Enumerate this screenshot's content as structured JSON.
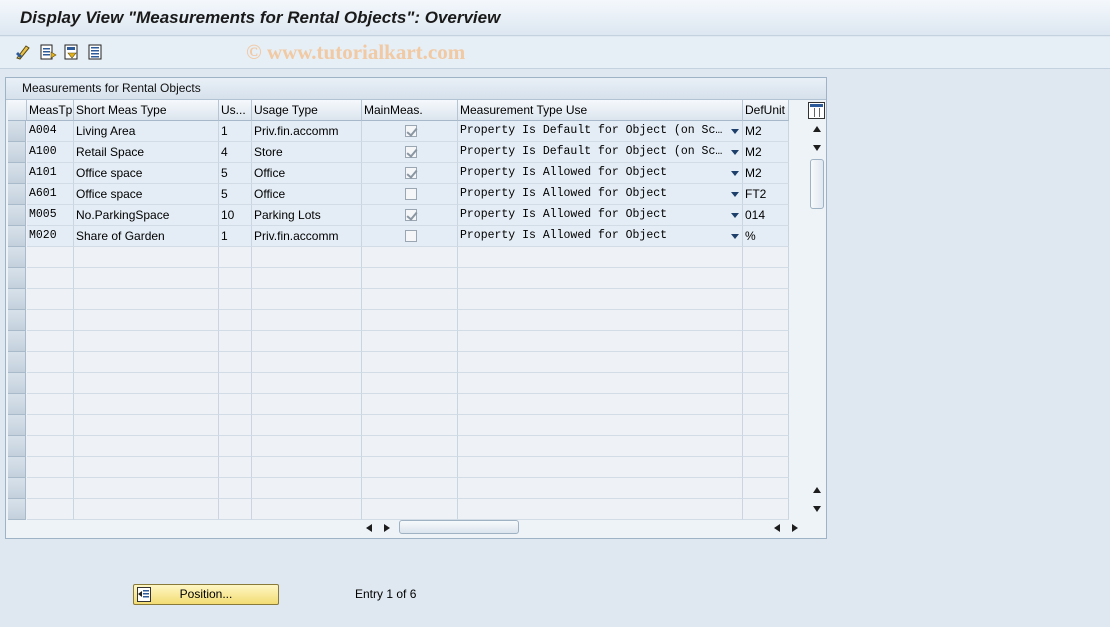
{
  "window": {
    "title": "Display View \"Measurements for Rental Objects\": Overview",
    "watermark": "© www.tutorialkart.com"
  },
  "toolbar": {
    "buttons": [
      {
        "icon": "edit-glasses-icon"
      },
      {
        "icon": "details-icon"
      },
      {
        "icon": "previous-entry-icon"
      },
      {
        "icon": "next-entry-icon"
      }
    ]
  },
  "table": {
    "title": "Measurements for Rental Objects",
    "columns": [
      "MeasTp",
      "Short Meas Type",
      "Us...",
      "Usage Type",
      "MainMeas.",
      "Measurement Type Use",
      "DefUnit"
    ],
    "rows": [
      {
        "meastp": "A004",
        "short": "Living Area",
        "us": "1",
        "usage": "Priv.fin.accomm",
        "main": true,
        "use": "Property Is Default for Object (on Sc…",
        "unit": "M2"
      },
      {
        "meastp": "A100",
        "short": "Retail Space",
        "us": "4",
        "usage": "Store",
        "main": true,
        "use": "Property Is Default for Object (on Sc…",
        "unit": "M2"
      },
      {
        "meastp": "A101",
        "short": "Office space",
        "us": "5",
        "usage": "Office",
        "main": true,
        "use": "Property Is Allowed for Object",
        "unit": "M2"
      },
      {
        "meastp": "A601",
        "short": "Office space",
        "us": "5",
        "usage": "Office",
        "main": false,
        "use": "Property Is Allowed for Object",
        "unit": "FT2"
      },
      {
        "meastp": "M005",
        "short": "No.ParkingSpace",
        "us": "10",
        "usage": "Parking Lots",
        "main": true,
        "use": "Property Is Allowed for Object",
        "unit": "014"
      },
      {
        "meastp": "M020",
        "short": "Share of Garden",
        "us": "1",
        "usage": "Priv.fin.accomm",
        "main": false,
        "use": "Property Is Allowed for Object",
        "unit": "%"
      }
    ],
    "empty_rows": 13
  },
  "footer": {
    "position_button": "Position...",
    "entry_text": "Entry 1 of 6"
  }
}
